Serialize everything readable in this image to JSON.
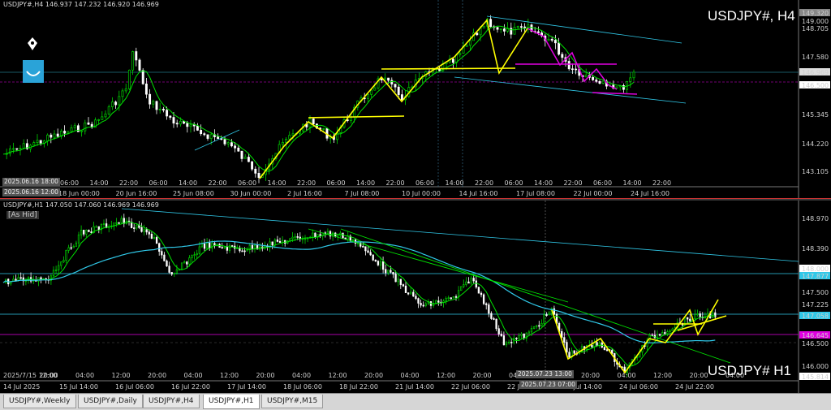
{
  "top": {
    "header": "USDJPY#,H4  146.937 147.232 146.920 146.969",
    "symbol_label": "USDJPY#, H4",
    "price_ticks": [
      "149.320",
      "149.000",
      "148.705",
      "147.580",
      "146.969",
      "146.500",
      "145.345",
      "144.220",
      "143.105"
    ],
    "time_ticks": [
      "06:00",
      "14:00",
      "22:00",
      "06:00",
      "14:00",
      "22:00",
      "06:00",
      "14:00",
      "22:00",
      "06:00",
      "14:00",
      "22:00",
      "06:00",
      "14:00",
      "22:00",
      "06:00",
      "14:00",
      "22:00",
      "06:00",
      "14:00",
      "22:00"
    ],
    "date_ticks": [
      "18 Jun 00:00",
      "20 Jun 16:00",
      "25 Jun 08:00",
      "30 Jun 00:00",
      "2 Jul 16:00",
      "7 Jul 08:00",
      "10 Jul 00:00",
      "14 Jul 16:00",
      "17 Jul 08:00",
      "22 Jul 00:00",
      "24 Jul 16:00"
    ],
    "time_tag": "2025.06.16 18:00",
    "date_tag": "2025.06.16 12:00"
  },
  "bottom": {
    "header": "USDJPY#,H1  147.050 147.060 146.969 146.969",
    "ask_label": "[As Hid]",
    "symbol_label": "USDJPY# H1",
    "price_ticks": [
      "148.970",
      "148.390",
      "148.000",
      "147.877",
      "147.500",
      "147.225",
      "147.058",
      "146.645",
      "146.500",
      "146.000",
      "145.814"
    ],
    "time_ticks": [
      "14 Jul 2025",
      "15 Jul 14:00",
      "16 Jul 06:00",
      "16 Jul 22:00",
      "17 Jul 14:00",
      "18 Jul 06:00",
      "18 Jul 22:00",
      "21 Jul 14:00",
      "22 Jul 06:00",
      "22 Jul 22:00",
      "23 Jul 14:00",
      "24 Jul 06:00",
      "24 Jul 22:00"
    ],
    "upper_time_ticks": [
      "2025/7/15 12:00",
      "20:00",
      "04:00",
      "12:00",
      "20:00",
      "04:00",
      "12:00",
      "20:00",
      "04:00",
      "12:00",
      "20:00",
      "04:00",
      "12:00",
      "20:00",
      "04:00",
      "12:00",
      "20:00",
      "04:00",
      "12:00",
      "20:00",
      "04:00"
    ],
    "tag_a": "2025.07.23 13:00",
    "tag_b": "2025.07.23 07:00"
  },
  "tabs": [
    "USDJPY#,Weekly",
    "USDJPY#,Daily",
    "USDJPY#,H4",
    "USDJPY#,H1",
    "USDJPY#,M15"
  ],
  "active_tab": "USDJPY#,H1",
  "colors": {
    "bull": "#00d000",
    "bear": "#ffffff",
    "ma_fast": "#00e000",
    "ma_slow": "#30c8e8",
    "trend": "#ffff00",
    "level_magenta": "#e000e0",
    "level_cyan": "#30c8e8"
  }
}
